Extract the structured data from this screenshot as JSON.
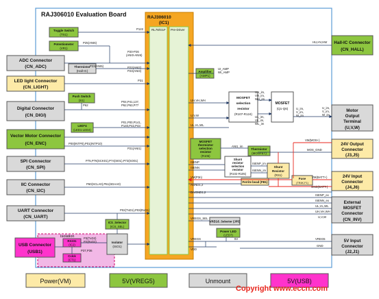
{
  "title": "RAJ306010 Evaluation Board",
  "ic": {
    "name": "RAJ306010",
    "ref": "(IC1)",
    "core": "RL78/G1F",
    "driver": "Pre-Driver"
  },
  "left_connectors": [
    {
      "name": "ADC Connector",
      "ref": "(CN_ADC)"
    },
    {
      "name": "LED light Connector",
      "ref": "(CN_LIGHT)"
    },
    {
      "name": "Digital Connector",
      "ref": "(CN_DIGI)"
    },
    {
      "name": "Vector Motor Connector",
      "ref": "(CN_ENC)"
    },
    {
      "name": "SPI Connector",
      "ref": "(CN_SPI)"
    },
    {
      "name": "IIC Connector",
      "ref": "(CN_I2C)"
    },
    {
      "name": "UART Connector",
      "ref": "(CN_UART)"
    },
    {
      "name": "USB Connector",
      "ref": "(USB1)"
    }
  ],
  "right_connectors": [
    {
      "name": "Hall-IC Connector",
      "ref": "(CN_HALL)"
    },
    {
      "name": "Motor Output Terminal",
      "ref": "(U,V,W)"
    },
    {
      "name": "24V Output Connector",
      "ref": "(J3,J5)"
    },
    {
      "name": "24V Input Connector",
      "ref": "(J4,J6)"
    },
    {
      "name": "External MOSFET Connector",
      "ref": "(CN_INV)"
    },
    {
      "name": "5V Input Connector",
      "ref": "(J2,J1)"
    }
  ],
  "parts": {
    "toggle": [
      "Toggle Switch",
      "(TS1)"
    ],
    "pot": [
      "Potentiometer",
      "(VR1)"
    ],
    "thermistor_hall": [
      "Thermistor",
      "(Hall-IC)"
    ],
    "push": [
      "Push Switch",
      "(S1)"
    ],
    "led": [
      "LED*4",
      "(LED1-LED4)"
    ],
    "amp": [
      "Amplifier",
      "(AMP1)"
    ],
    "mos_sel": [
      "MOSFET",
      "selection",
      "resistor",
      "(R107-R124)"
    ],
    "mosfet": [
      "MOSFET",
      "(Q1-Q6)"
    ],
    "therm_sel": [
      "MOSFET",
      "thermistor",
      "selection",
      "resistor",
      "(R106)"
    ],
    "therm_mos": [
      "Thermistor",
      "(MOSFET)"
    ],
    "shunt_sel": [
      "Shunt",
      "resistor",
      "selection",
      "resistor",
      "(R102-R105)"
    ],
    "shunt": [
      "Shunt",
      "Resistor",
      "(RS1)"
    ],
    "ferrite": "Ferrite bead (FB1)",
    "fuse": [
      "Fuse",
      "(TR4K,F1)"
    ],
    "vreg_sel": "VREG5_Selector (JP5)",
    "power_led": [
      "Power LED",
      "(LED7)"
    ],
    "ics_sel": [
      "ICS_Selector",
      "(ICS_SEL)"
    ],
    "isolator": [
      "Isolator",
      "(ISO1)"
    ],
    "rx": [
      "RX231",
      "(IC2)"
    ],
    "cclk": [
      "Cclck",
      "(CT1)"
    ],
    "isolation": "Isolation"
  },
  "signals": {
    "p122": "P122",
    "p25": "P25(ANI6)",
    "p20": [
      "P20-P26",
      "(ANI0-ANI6)"
    ],
    "p23": "P23(ANI5)",
    "p22": [
      "P22(ANI2)",
      "P23(ANI3)"
    ],
    "p31": "P31",
    "p62": "P62",
    "p04": [
      "P04,P41,137,",
      "P62,P63,P77"
    ],
    "p01": [
      "P01,P00,P141,",
      "P140,P42,P43"
    ],
    "p00": "P00(INTP0),P01(INTP10)",
    "p21": "P21(ANI1)",
    "p75": "P75,P76(SCK01),P74(SI01),P73(SO01)",
    "p60": "P60(SCLA0),P61(SDAA0)",
    "p02": "P02(TxD1),P03(RxD1)",
    "p3": [
      "P3(TxD2)",
      "P2(RxD2)"
    ],
    "p37": "P37,P36",
    "hu": "HU,HV,HW",
    "ul_amp": [
      "UI_AMP",
      "WI_AMP"
    ],
    "uh": [
      "UH_im,",
      "VH_im,",
      "WH_im"
    ],
    "ul": [
      "UL_im,",
      "VL_im,",
      "WL_im"
    ],
    "u_im": [
      "U_im,",
      "V_im,",
      "W_im"
    ],
    "uvw": "U,V,W",
    "uh2": "UH,VH,WH",
    "uvw2": "U,V,W",
    "ul2": "UL,VL,WL",
    "vm_mos": "VM(MOS+)",
    "mos_gnd": "MOS_GND",
    "ani1": "ANI1_im",
    "isenp": "ISENP",
    "isenn": "ISENN",
    "isenp_im": "ISENP_im",
    "isenn_im": "ISENN_im",
    "vm": "VM(P3n)",
    "agnd": "AGND1,2",
    "drvgnd": "DrvGND1,2",
    "vm_batt": "VM(BATT+)",
    "gnd_batt": "GND(BATT-)",
    "isenp_ex": "ISENP_ex",
    "isenn_ex": "ISENN_ex",
    "ul_vl": "UL,VL,WL",
    "uh_vh": "UH,VH,WH",
    "uvw3": "U,V,W",
    "vregs_sel": "VREGS_SEL",
    "vregs": "VREGS",
    "vdd": "VDD",
    "fivev": "5V",
    "vregs_r": "VREG5",
    "gnd": "GND"
  },
  "legend": [
    "Power(VM)",
    "5V(VREG5)",
    "Unmount",
    "5V(USB)"
  ],
  "watermark": "Copyright www.eccn.com",
  "colors": {
    "board": "#5b9bd5",
    "ic": "#f5a623",
    "green": "#8dc63f",
    "gray": "#d9d9d9",
    "yellow": "#fdeaa7",
    "magenta": "#ff33cc",
    "pink": "#f2b8e6",
    "red": "#e8251c"
  }
}
